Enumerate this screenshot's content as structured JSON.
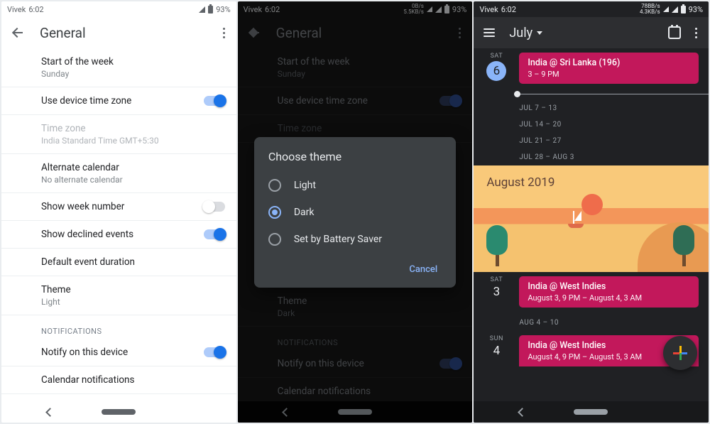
{
  "status": {
    "name": "Vivek",
    "time": "6:02",
    "battery": "93%",
    "p2_kbs_top": "0B/s",
    "p2_kbs_bot": "5.5KB/s",
    "p3_kbs_top": "78BB/s",
    "p3_kbs_bot": "4.3KB/s"
  },
  "settings": {
    "title": "General",
    "start_week": "Start of the week",
    "start_week_val": "Sunday",
    "use_tz": "Use device time zone",
    "tz": "Time zone",
    "tz_val": "India Standard Time  GMT+5:30",
    "alt_cal": "Alternate calendar",
    "alt_cal_val": "No alternate calendar",
    "week_num": "Show week number",
    "declined": "Show declined events",
    "default_dur": "Default event duration",
    "theme": "Theme",
    "theme_light_val": "Light",
    "theme_dark_val": "Dark",
    "section_notif": "NOTIFICATIONS",
    "notify_device": "Notify on this device",
    "cal_notifs": "Calendar notifications"
  },
  "dialog": {
    "title": "Choose theme",
    "opt_light": "Light",
    "opt_dark": "Dark",
    "opt_battery": "Set by Battery Saver",
    "cancel": "Cancel"
  },
  "cal": {
    "month": "July",
    "today_dow": "SAT",
    "today_num": "6",
    "ev1_title": "India @ Sri Lanka (196)",
    "ev1_time": "3 – 9 PM",
    "range1": "JUL 7 – 13",
    "range2": "JUL 14 – 20",
    "range3": "JUL 21 – 27",
    "range4": "JUL 28 – AUG 3",
    "banner_month": "August 2019",
    "aug3_dow": "SAT",
    "aug3_num": "3",
    "ev2_title": "India @ West Indies",
    "ev2_time": "August 3, 9 PM – August 4, 3 AM",
    "range5": "AUG 4 – 10",
    "aug4_dow": "SUN",
    "aug4_num": "4",
    "ev3_title": "India @ West Indies",
    "ev3_time": "August 4, 9 PM – August 5, 3 AM"
  }
}
